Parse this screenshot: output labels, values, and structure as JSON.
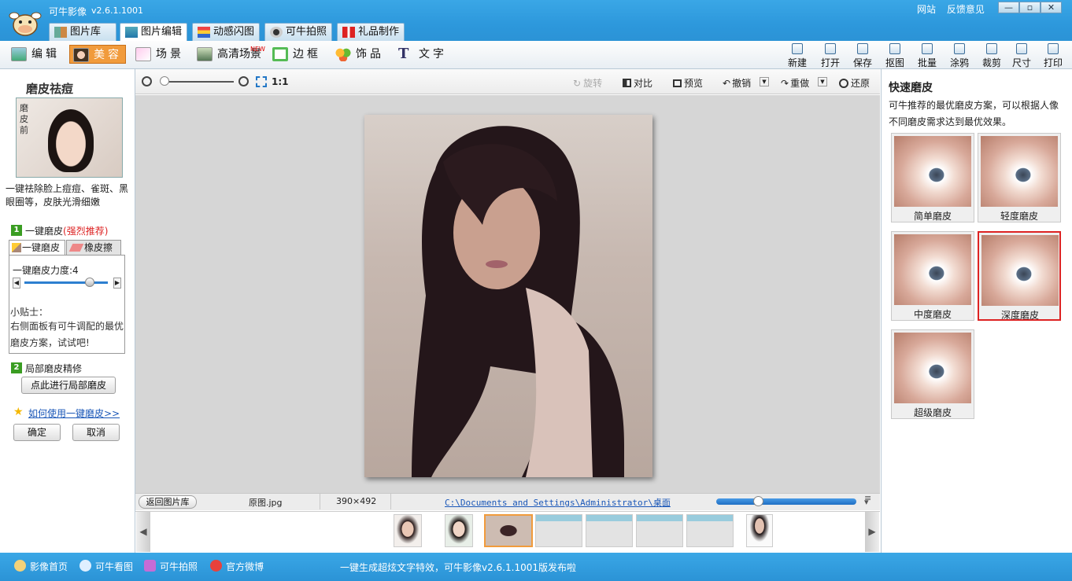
{
  "app": {
    "title": "可牛影像",
    "version": "v2.6.1.1001"
  },
  "top_links": [
    "网站",
    "反馈意见"
  ],
  "window_controls": [
    "—",
    "▫",
    "✕"
  ],
  "main_tabs": [
    {
      "label": "图片库",
      "active": false
    },
    {
      "label": "图片编辑",
      "active": true
    },
    {
      "label": "动感闪图",
      "active": false
    },
    {
      "label": "可牛拍照",
      "active": false
    },
    {
      "label": "礼品制作",
      "active": false
    }
  ],
  "edit_tools": [
    {
      "label": "编辑",
      "active": false
    },
    {
      "label": "美容",
      "active": true
    },
    {
      "label": "场景",
      "active": false
    },
    {
      "label": "高清场景",
      "active": false,
      "badge": "NEW"
    },
    {
      "label": "边框",
      "active": false
    },
    {
      "label": "饰品",
      "active": false
    },
    {
      "label": "文字",
      "active": false
    }
  ],
  "right_tools": [
    "新建",
    "打开",
    "保存",
    "抠图",
    "批量",
    "涂鸦",
    "裁剪",
    "尺寸",
    "打印"
  ],
  "left_panel": {
    "title": "磨皮祛痘",
    "photo_tag": "磨皮前",
    "description": "一键祛除脸上痘痘、雀斑、黑眼圈等，皮肤光滑细嫩",
    "step1_num": "1",
    "step1_label": "一键磨皮",
    "step1_hint": "(强烈推荐)",
    "subtabs": [
      "一键磨皮",
      "橡皮擦"
    ],
    "strength_label": "一键磨皮力度:",
    "strength_value": "4",
    "strength_fraction": 0.78,
    "tip_title": "小贴士：",
    "tip_text": "右侧面板有可牛调配的最优磨皮方案，试试吧!",
    "step2_num": "2",
    "step2_label": "局部磨皮精修",
    "local_button": "点此进行局部磨皮",
    "help_link": "如何使用一键磨皮>>",
    "ok": "确定",
    "cancel": "取消"
  },
  "zoom_bar": {
    "ratio_label": "1:1",
    "zoom_fraction": 0.04,
    "actions": [
      "旋转",
      "对比",
      "预览",
      "撤销",
      "重做",
      "还原"
    ]
  },
  "status": {
    "back_button": "返回图片库",
    "filename": "原图.jpg",
    "dimensions": "390×492",
    "path": "C:\\Documents and Settings\\Administrator\\桌面",
    "thumb_size_fraction": 0.3
  },
  "right_panel": {
    "title": "快速磨皮",
    "description": "可牛推荐的最优磨皮方案，可以根据人像不同磨皮需求达到最优效果。",
    "presets": [
      {
        "label": "简单磨皮",
        "selected": false
      },
      {
        "label": "轻度磨皮",
        "selected": false
      },
      {
        "label": "中度磨皮",
        "selected": false
      },
      {
        "label": "深度磨皮",
        "selected": true
      },
      {
        "label": "超级磨皮",
        "selected": false
      }
    ]
  },
  "bottom_bar": {
    "links": [
      "影像首页",
      "可牛看图",
      "可牛拍照",
      "官方微博"
    ],
    "message": "一键生成超炫文字特效，可牛影像v2.6.1.1001版发布啦"
  }
}
